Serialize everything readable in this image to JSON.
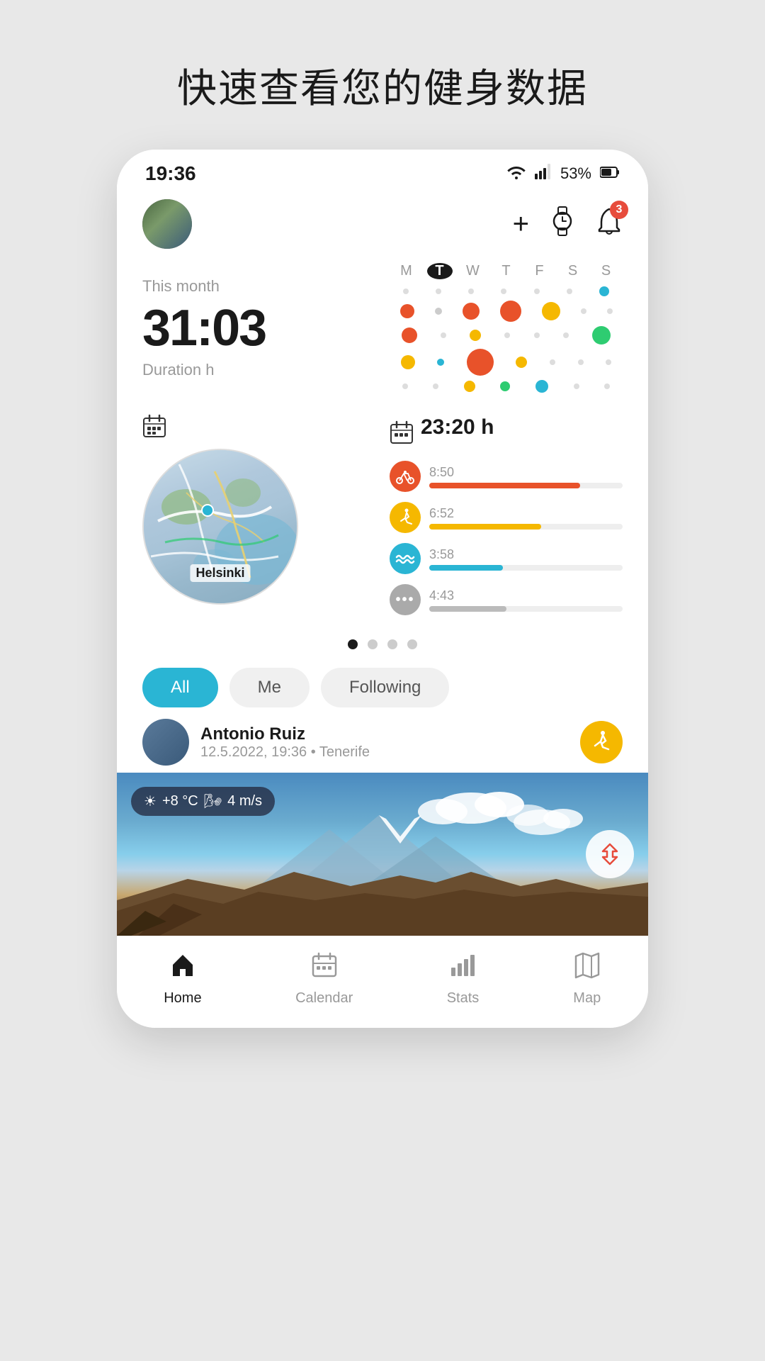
{
  "page": {
    "title": "快速查看您的健身数据"
  },
  "status": {
    "time": "19:36",
    "wifi": "wifi",
    "signal": "signal",
    "battery": "53%",
    "battery_icon": "🔋"
  },
  "header": {
    "add_label": "+",
    "watch_label": "⌚",
    "notification_count": "3"
  },
  "stats": {
    "this_month": "This month",
    "time_value": "31:03",
    "duration_label": "Duration h"
  },
  "calendar": {
    "days": [
      "M",
      "T",
      "W",
      "T",
      "F",
      "S",
      "S"
    ],
    "today_index": 1
  },
  "activity_total": "23:20 h",
  "activities": [
    {
      "icon": "🚴",
      "color": "#e8522a",
      "time": "8:50",
      "bar_width": "78%",
      "bar_color": "#e8522a"
    },
    {
      "icon": "🏃",
      "color": "#f5b800",
      "time": "6:52",
      "bar_width": "58%",
      "bar_color": "#f5b800"
    },
    {
      "icon": "🏊",
      "color": "#2ab5d4",
      "time": "3:58",
      "bar_width": "38%",
      "bar_color": "#2ab5d4"
    },
    {
      "icon": "•••",
      "color": "#aaa",
      "time": "4:43",
      "bar_width": "40%",
      "bar_color": "#bbb"
    }
  ],
  "map": {
    "city": "Helsinki"
  },
  "filter_tabs": {
    "all": "All",
    "me": "Me",
    "following": "Following"
  },
  "feed_item": {
    "name": "Antonio Ruiz",
    "meta": "12.5.2022, 19:36 • Tenerife",
    "activity_icon": "🏃"
  },
  "weather": {
    "temp": "+8 °C",
    "wind": "4 m/s"
  },
  "nav": {
    "home": "Home",
    "calendar": "Calendar",
    "stats": "Stats",
    "map": "Map"
  },
  "dots": [
    [
      {
        "size": 8,
        "color": "#ddd"
      },
      {
        "size": 8,
        "color": "#ddd"
      },
      {
        "size": 14,
        "color": "#2ab5d4"
      }
    ],
    [
      {
        "size": 20,
        "color": "#e8522a"
      },
      {
        "size": 10,
        "color": "#ccc"
      },
      {
        "size": 24,
        "color": "#e8522a"
      },
      {
        "size": 30,
        "color": "#e8522a"
      },
      {
        "size": 26,
        "color": "#f5b800"
      },
      {
        "size": 8,
        "color": "#ddd"
      },
      {
        "size": 8,
        "color": "#ddd"
      }
    ],
    [
      {
        "size": 22,
        "color": "#e8522a"
      },
      {
        "size": 8,
        "color": "#ddd"
      },
      {
        "size": 16,
        "color": "#f5b800"
      },
      {
        "size": 8,
        "color": "#ddd"
      },
      {
        "size": 8,
        "color": "#ddd"
      },
      {
        "size": 8,
        "color": "#ddd"
      },
      {
        "size": 26,
        "color": "#2ecc71"
      }
    ],
    [
      {
        "size": 20,
        "color": "#f5b800"
      },
      {
        "size": 10,
        "color": "#2ab5d4"
      },
      {
        "size": 38,
        "color": "#e8522a"
      },
      {
        "size": 16,
        "color": "#f5b800"
      },
      {
        "size": 8,
        "color": "#ddd"
      },
      {
        "size": 8,
        "color": "#ddd"
      },
      {
        "size": 8,
        "color": "#ddd"
      }
    ],
    [
      {
        "size": 8,
        "color": "#ddd"
      },
      {
        "size": 8,
        "color": "#ddd"
      },
      {
        "size": 16,
        "color": "#f5b800"
      },
      {
        "size": 14,
        "color": "#2ecc71"
      },
      {
        "size": 18,
        "color": "#2ab5d4"
      },
      {
        "size": 8,
        "color": "#ddd"
      },
      {
        "size": 8,
        "color": "#ddd"
      }
    ]
  ]
}
